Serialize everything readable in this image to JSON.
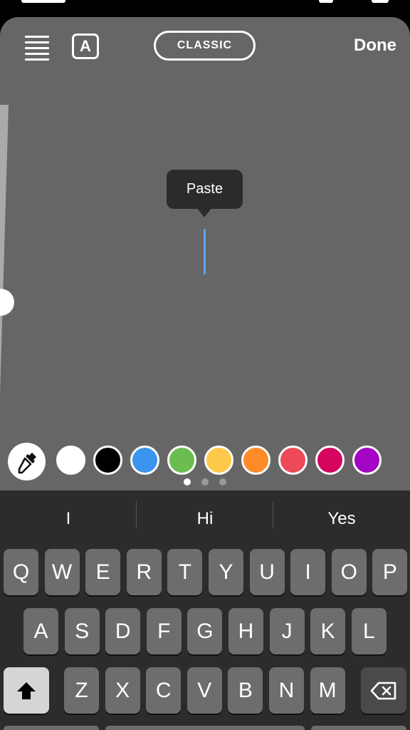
{
  "toolbar": {
    "menu_icon": "text-align-icon",
    "font_icon": "A",
    "style_label": "CLASSIC",
    "done_label": "Done"
  },
  "size_slider": {
    "value": 0.74
  },
  "text_editor": {
    "paste_label": "Paste",
    "text": ""
  },
  "colors": {
    "eyedropper": "eyedropper-icon",
    "swatches": [
      "#ffffff",
      "#000000",
      "#3a95ee",
      "#6bbd4f",
      "#fec84a",
      "#fc8b28",
      "#ec4a58",
      "#d4045f",
      "#a404c4"
    ],
    "page_indicator": {
      "count": 3,
      "active": 0
    }
  },
  "keyboard": {
    "suggestions": [
      "I",
      "Hi",
      "Yes"
    ],
    "row1": [
      "Q",
      "W",
      "E",
      "R",
      "T",
      "Y",
      "U",
      "I",
      "O",
      "P"
    ],
    "row2": [
      "A",
      "S",
      "D",
      "F",
      "G",
      "H",
      "J",
      "K",
      "L"
    ],
    "row3": [
      "Z",
      "X",
      "C",
      "V",
      "B",
      "N",
      "M"
    ],
    "shift_icon": "shift-icon",
    "delete_icon": "backspace-icon"
  }
}
